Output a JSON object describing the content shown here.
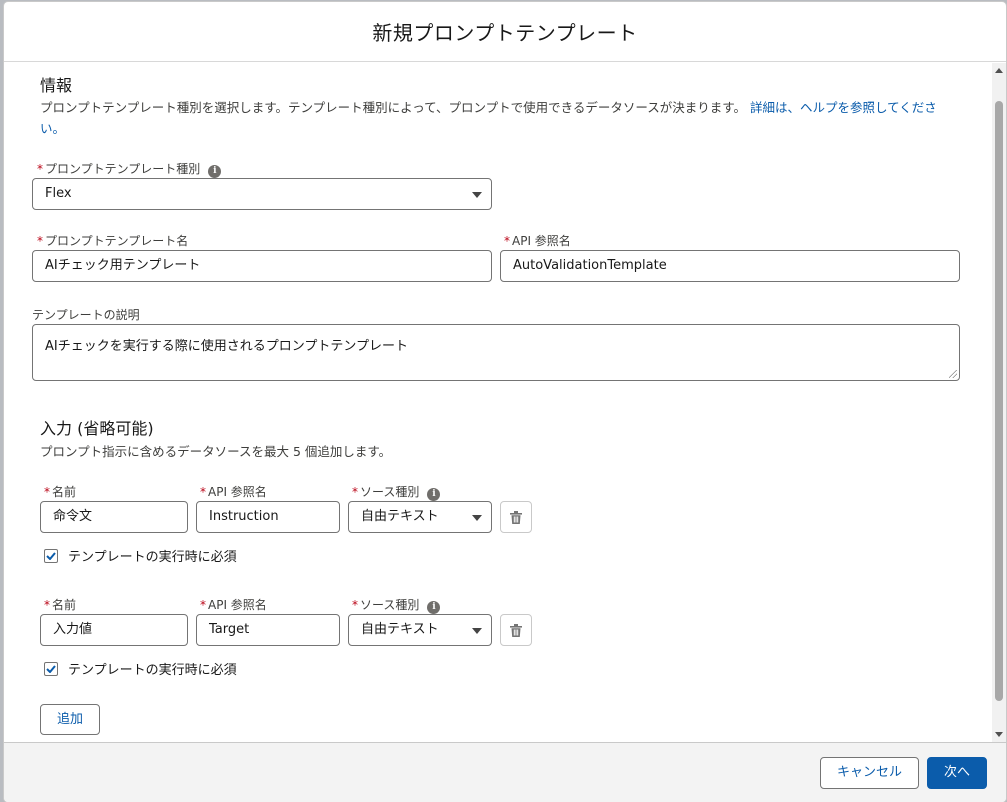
{
  "modal": {
    "title": "新規プロンプトテンプレート"
  },
  "info_section": {
    "title": "情報",
    "description": "プロンプトテンプレート種別を選択します。テンプレート種別によって、プロンプトで使用できるデータソースが決まります。",
    "help_link": "詳細は、ヘルプを参照してください。"
  },
  "fields": {
    "template_type": {
      "label": "プロンプトテンプレート種別",
      "value": "Flex",
      "required_mark": "*"
    },
    "template_name": {
      "label": "プロンプトテンプレート名",
      "value": "AIチェック用テンプレート",
      "required_mark": "*"
    },
    "api_name": {
      "label": "API 参照名",
      "value": "AutoValidationTemplate",
      "required_mark": "*"
    },
    "description": {
      "label": "テンプレートの説明",
      "value": "AIチェックを実行する際に使用されるプロンプトテンプレート"
    }
  },
  "inputs_section": {
    "title": "入力 (省略可能)",
    "description": "プロンプト指示に含めるデータソースを最大 5 個追加します。",
    "rows": [
      {
        "name_label": "名前",
        "name_value": "命令文",
        "api_label": "API 参照名",
        "api_value": "Instruction",
        "source_label": "ソース種別",
        "source_value": "自由テキスト",
        "required_label": "テンプレートの実行時に必須",
        "required_checked": true
      },
      {
        "name_label": "名前",
        "name_value": "入力値",
        "api_label": "API 参照名",
        "api_value": "Target",
        "source_label": "ソース種別",
        "source_value": "自由テキスト",
        "required_label": "テンプレートの実行時に必須",
        "required_checked": true
      }
    ],
    "add_button": "追加"
  },
  "footer": {
    "cancel_label": "キャンセル",
    "next_label": "次へ"
  },
  "colors": {
    "brand": "#0b5cab",
    "required": "#ba0517"
  },
  "icons": {
    "info": "info-icon",
    "delete": "trash-icon",
    "dropdown": "chevron-down-icon",
    "check": "checkmark-icon"
  }
}
